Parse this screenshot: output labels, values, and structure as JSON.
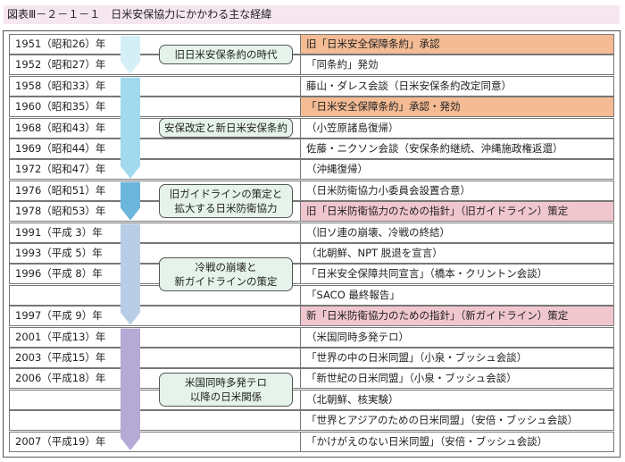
{
  "title": "図表Ⅲ－２－１－１　日米安保協力にかかわる主な経緯",
  "rows": [
    {
      "year": "1951（昭和26）年",
      "event": "旧「日米安全保障条約」承認",
      "hl": "orange"
    },
    {
      "year": "1952（昭和27）年",
      "event": "「同条約」発効",
      "hl": ""
    },
    {
      "year": "1958（昭和33）年",
      "event": "藤山・ダレス会談（日米安保条約改定同意）",
      "hl": ""
    },
    {
      "year": "1960（昭和35）年",
      "event": "「日米安全保障条約」承認・発効",
      "hl": "orange"
    },
    {
      "year": "1968（昭和43）年",
      "event": "（小笠原諸島復帰）",
      "hl": ""
    },
    {
      "year": "1969（昭和44）年",
      "event": "佐藤・ニクソン会談（安保条約継続、沖縄施政権返還）",
      "hl": ""
    },
    {
      "year": "1972（昭和47）年",
      "event": "（沖縄復帰）",
      "hl": ""
    },
    {
      "year": "1976（昭和51）年",
      "event": "（日米防衛協力小委員会設置合意）",
      "hl": ""
    },
    {
      "year": "1978（昭和53）年",
      "event": "旧「日米防衛協力のための指針」（旧ガイドライン）策定",
      "hl": "pink"
    },
    {
      "year": "1991（平成 3）年",
      "event": "（旧ソ連の崩壊、冷戦の終結）",
      "hl": ""
    },
    {
      "year": "1993（平成 5）年",
      "event": "（北朝鮮、NPT 脱退を宣言）",
      "hl": ""
    },
    {
      "year": "1996（平成 8）年",
      "event": "「日米安全保障共同宣言」（橋本・クリントン会談）",
      "hl": ""
    },
    {
      "year": "",
      "event": "「SACO 最終報告」",
      "hl": ""
    },
    {
      "year": "1997（平成 9）年",
      "event": "新「日米防衛協力のための指針」（新ガイドライン）策定",
      "hl": "pink"
    },
    {
      "year": "2001（平成13）年",
      "event": "（米国同時多発テロ）",
      "hl": ""
    },
    {
      "year": "2003（平成15）年",
      "event": "「世界の中の日米同盟」（小泉・ブッシュ会談）",
      "hl": ""
    },
    {
      "year": "2006（平成18）年",
      "event": "「新世紀の日米同盟」（小泉・ブッシュ会談）",
      "hl": ""
    },
    {
      "year": "",
      "event": "（北朝鮮、核実験）",
      "hl": ""
    },
    {
      "year": "",
      "event": "「世界とアジアのための日米同盟」（安倍・ブッシュ会談）",
      "hl": ""
    },
    {
      "year": "2007（平成19）年",
      "event": "「かけがえのない日米同盟」（安倍・ブッシュ会談）",
      "hl": ""
    }
  ],
  "eras": [
    {
      "label": "旧日米安保条約の時代",
      "from": 0,
      "to": 1,
      "color": "#d4f0f6"
    },
    {
      "label": "安保改定と新日米安保条約",
      "from": 2,
      "to": 6,
      "color": "#a2d9ef"
    },
    {
      "label": "旧ガイドラインの策定と\n拡大する日米防衛協力",
      "from": 7,
      "to": 8,
      "color": "#6cb6dc"
    },
    {
      "label": "冷戦の崩壊と\n新ガイドラインの策定",
      "from": 9,
      "to": 13,
      "color": "#b9cde6"
    },
    {
      "label": "米国同時多発テロ\n以降の日米関係",
      "from": 14,
      "to": 19,
      "color": "#b5a9d6"
    }
  ]
}
